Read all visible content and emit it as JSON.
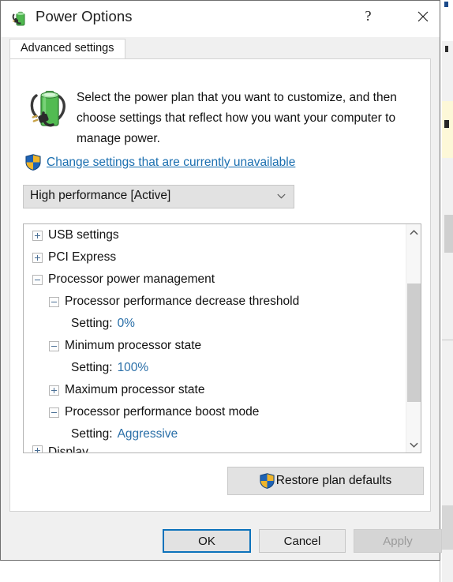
{
  "window": {
    "title": "Power Options",
    "app_icon": "battery-plug-icon",
    "help_label": "?",
    "close_label": "✕"
  },
  "tabs": [
    {
      "label": "Advanced settings",
      "selected": true
    }
  ],
  "header": {
    "icon": "battery-plug-icon",
    "description": "Select the power plan that you want to customize, and then choose settings that reflect how you want your computer to manage power.",
    "change_settings_link": "Change settings that are currently unavailable",
    "shield_icon": "uac-shield-icon"
  },
  "plan_select": {
    "value": "High performance [Active]",
    "arrow_icon": "chevron-down-icon"
  },
  "settings_tree": {
    "rows": [
      {
        "level": 0,
        "expander": "plus",
        "label": "USB settings"
      },
      {
        "level": 0,
        "expander": "plus",
        "label": "PCI Express"
      },
      {
        "level": 0,
        "expander": "minus",
        "label": "Processor power management"
      },
      {
        "level": 1,
        "expander": "minus",
        "label": "Processor performance decrease threshold"
      },
      {
        "level": 2,
        "expander": "none",
        "label": "Setting:",
        "value": "0%"
      },
      {
        "level": 1,
        "expander": "minus",
        "label": "Minimum processor state"
      },
      {
        "level": 2,
        "expander": "none",
        "label": "Setting:",
        "value": "100%"
      },
      {
        "level": 1,
        "expander": "plus",
        "label": "Maximum processor state"
      },
      {
        "level": 1,
        "expander": "minus",
        "label": "Processor performance boost mode"
      },
      {
        "level": 2,
        "expander": "none",
        "label": "Setting:",
        "value": "Aggressive"
      },
      {
        "level": 0,
        "expander": "plus",
        "label": "Display",
        "clipped": true
      }
    ],
    "scrollbar": {
      "up_arrow_icon": "chevron-up-icon",
      "down_arrow_icon": "chevron-down-icon"
    }
  },
  "restore_button": {
    "label": "Restore plan defaults",
    "shield_icon": "uac-shield-icon"
  },
  "buttons": {
    "ok": "OK",
    "cancel": "Cancel",
    "apply": "Apply"
  },
  "colors": {
    "link": "#1b6fb0",
    "setting_value": "#2a6fa8",
    "focus_border": "#0c72bb",
    "dialog_bg": "#f0f0f0"
  }
}
